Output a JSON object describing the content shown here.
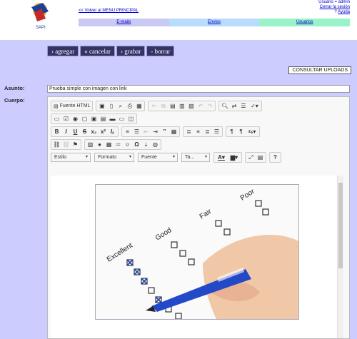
{
  "header": {
    "back_link": "<< Volver al MENU PRINCIPAL",
    "user_line": "Usuario = admin",
    "logout_link": "Cerrar la sesión",
    "help_link": "Ayuda",
    "help_prefix": "?"
  },
  "menu": [
    {
      "label": "E-mails",
      "color": "#c9c9f2"
    },
    {
      "label": "Envios",
      "color": "#b8dcfb"
    },
    {
      "label": "Usuarios",
      "color": "#99f2c8"
    }
  ],
  "actions": {
    "add": "› agregar",
    "cancel": "« cancelar",
    "save": "› grabar",
    "delete": "- borrar",
    "consult": "CONSULTAR UPLOADS"
  },
  "form": {
    "subject_label": "Asunto:",
    "subject_value": "Prueba simple con imagen con link",
    "body_label": "Cuerpo:"
  },
  "editor": {
    "source_button": "Fuente HTML",
    "style_combo": "Estilo",
    "format_combo": "Formato",
    "font_combo": "Fuente",
    "size_combo": "Ta...",
    "image_labels": [
      "Excellent",
      "Good",
      "Fair",
      "Poor"
    ]
  },
  "colors": {
    "main_bg": "#ccccff",
    "button_bg": "#333366"
  }
}
